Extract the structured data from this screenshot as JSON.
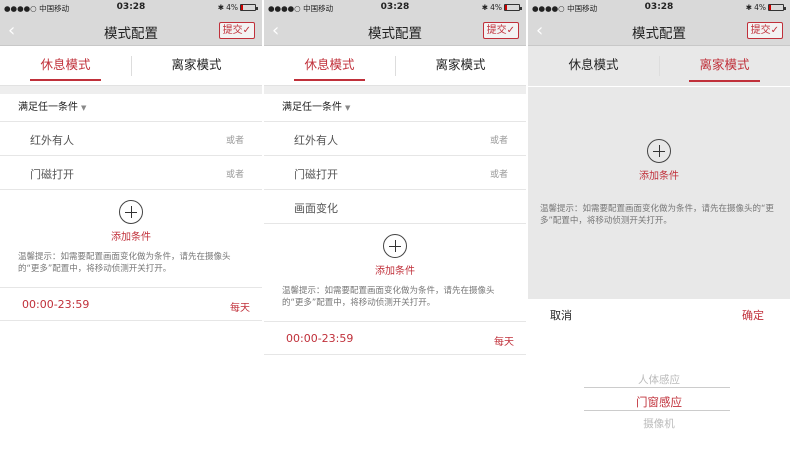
{
  "status": {
    "carrier": "●●●●○ 中国移动",
    "time": "03:28",
    "battery": "4%"
  },
  "nav": {
    "title": "模式配置",
    "submit": "提交✓",
    "back": "‹"
  },
  "tabs": [
    "休息模式",
    "离家模式"
  ],
  "condition_header": "满足任一条件",
  "or_text": "或者",
  "screen1": {
    "conditions": [
      "红外有人",
      "门磁打开"
    ]
  },
  "screen2": {
    "conditions": [
      "红外有人",
      "门磁打开",
      "画面变化"
    ]
  },
  "add_label": "添加条件",
  "hint": "温馨提示：如需要配置画面变化做为条件，请先在摄像头的“更多”配置中，将移动侦测开关打开。",
  "schedule": {
    "time": "00:00-23:59",
    "days": "每天"
  },
  "picker": {
    "cancel": "取消",
    "confirm": "确定",
    "options": [
      "人体感应",
      "门窗感应",
      "摄像机"
    ],
    "selected_index": 1
  },
  "colors": {
    "accent": "#c0303a",
    "bar": "#d9d9d9"
  },
  "icons": {
    "plus": "plus-circle-icon",
    "back": "chevron-left-icon",
    "check": "check-icon"
  }
}
